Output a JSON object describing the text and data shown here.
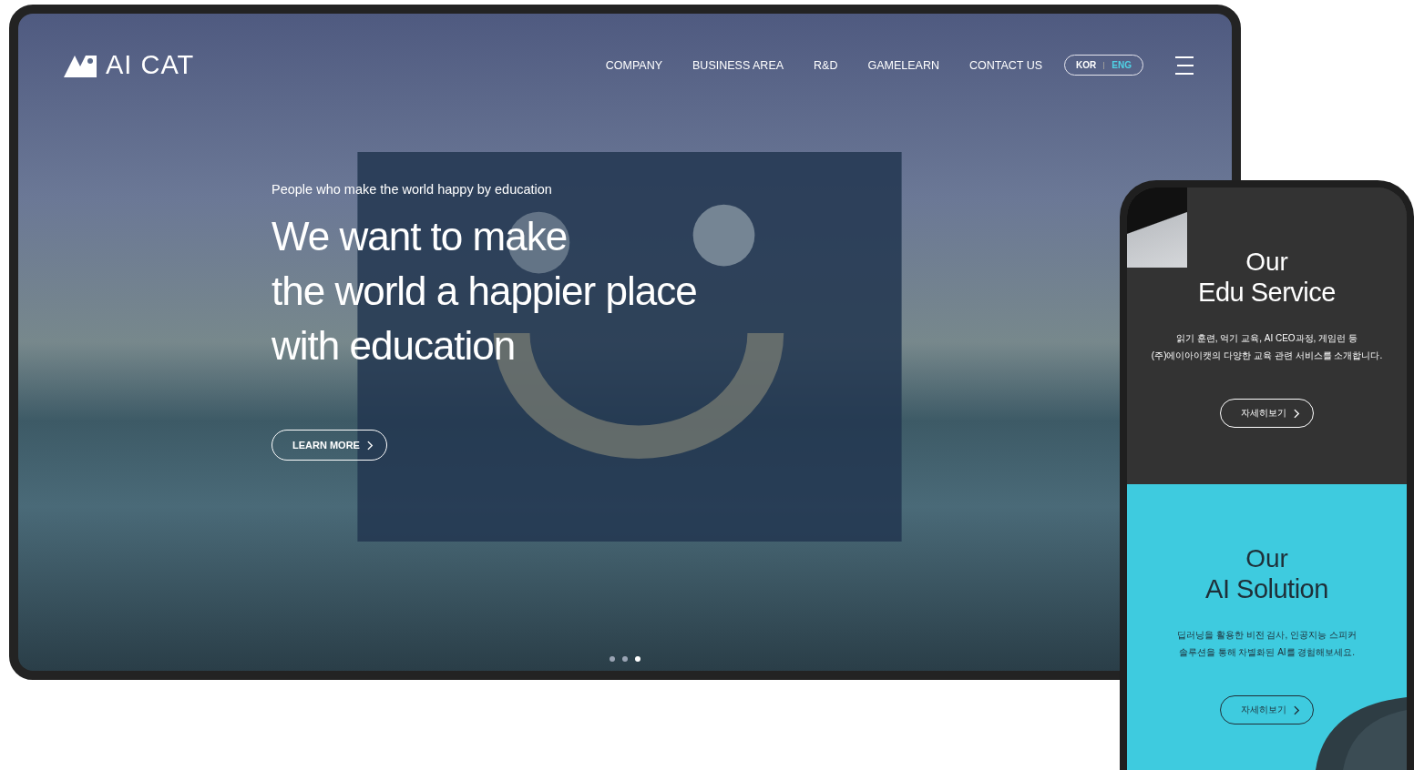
{
  "header": {
    "logo": "AI CAT",
    "nav": [
      "COMPANY",
      "BUSINESS AREA",
      "R&D",
      "GAMELEARN",
      "CONTACT US"
    ],
    "languages": [
      {
        "label": "KOR",
        "selected": false
      },
      {
        "label": "ENG",
        "selected": true
      }
    ]
  },
  "hero": {
    "tagline": "People who make the world happy by education",
    "headline": [
      "We want to make",
      "the world a happier place",
      "with education"
    ],
    "button": "LEARN MORE",
    "slides": [
      {
        "selected": false
      },
      {
        "selected": false
      },
      {
        "selected": true
      }
    ]
  },
  "mobile": {
    "sections": [
      {
        "kind": "dark",
        "title_small": "Our",
        "title": "Edu Service",
        "lines": [
          "읽기 훈련, 억기 교육, AI CEO과정, 게임런 등",
          "(주)에이아이캣의 다양한 교육 관련 서비스를 소개합니다."
        ],
        "button": "자세히보기"
      },
      {
        "kind": "cyan",
        "title_small": "Our",
        "title": "AI Solution",
        "lines": [
          "딥러닝을 활용한 비전 검사, 인공지능 스피커",
          "솔루션을 통해 차별화된 AI를 경험해보세요."
        ],
        "button": "자세히보기"
      }
    ]
  }
}
